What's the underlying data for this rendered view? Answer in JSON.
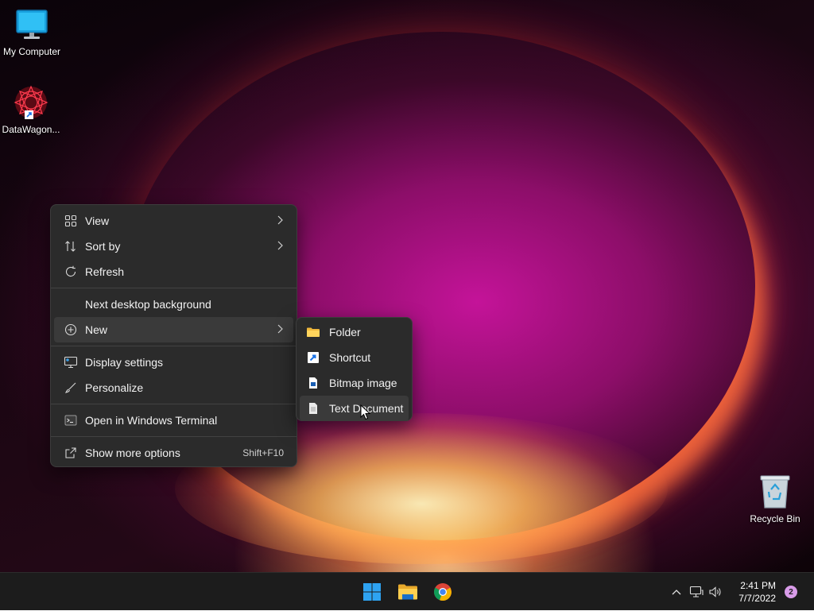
{
  "desktop": {
    "icons": [
      {
        "label": "My Computer",
        "icon": "monitor-icon"
      },
      {
        "label": "DataWagon...",
        "icon": "datawagon-app-icon"
      },
      {
        "label": "Recycle Bin",
        "icon": "recycle-bin-icon"
      }
    ]
  },
  "context_menu": {
    "items": [
      {
        "label": "View",
        "icon": "grid-icon",
        "has_submenu": true
      },
      {
        "label": "Sort by",
        "icon": "sort-icon",
        "has_submenu": true
      },
      {
        "label": "Refresh",
        "icon": "refresh-icon"
      },
      {
        "label": "Next desktop background"
      },
      {
        "label": "New",
        "icon": "plus-circle-icon",
        "has_submenu": true,
        "active": true
      },
      {
        "label": "Display settings",
        "icon": "display-icon"
      },
      {
        "label": "Personalize",
        "icon": "brush-icon"
      },
      {
        "label": "Open in Windows Terminal",
        "icon": "terminal-icon"
      },
      {
        "label": "Show more options",
        "icon": "share-icon",
        "shortcut": "Shift+F10"
      }
    ]
  },
  "submenu_new": {
    "items": [
      {
        "label": "Folder",
        "icon": "folder-icon"
      },
      {
        "label": "Shortcut",
        "icon": "shortcut-icon"
      },
      {
        "label": "Bitmap image",
        "icon": "bitmap-icon"
      },
      {
        "label": "Text Document",
        "icon": "text-document-icon",
        "hovered": true
      }
    ]
  },
  "taskbar": {
    "apps": [
      {
        "name": "Start",
        "icon": "windows-start-icon"
      },
      {
        "name": "File Explorer",
        "icon": "file-explorer-icon"
      },
      {
        "name": "Google Chrome",
        "icon": "chrome-icon"
      }
    ],
    "tray": {
      "time": "2:41 PM",
      "date": "7/7/2022",
      "notifications": "2"
    }
  },
  "colors": {
    "menu_bg": "#2b2b2b",
    "menu_hover": "#3a3a3a",
    "taskbar_bg": "#1c1c1c",
    "accent": "#0078d4",
    "notification_badge": "#d89be8"
  }
}
